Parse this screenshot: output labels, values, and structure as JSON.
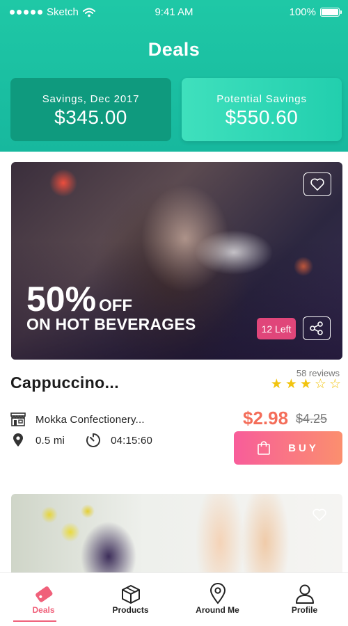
{
  "status_bar": {
    "carrier": "Sketch",
    "time": "9:41 AM",
    "battery": "100%",
    "battery_level": 1.0
  },
  "header": {
    "title": "Deals",
    "savings_cards": [
      {
        "label": "Savings, Dec 2017",
        "value": "$345.00"
      },
      {
        "label": "Potential Savings",
        "value": "$550.60"
      }
    ]
  },
  "deal": {
    "discount_percent": "50%",
    "discount_off": "OFF",
    "discount_subtitle": "ON HOT BEVERAGES",
    "stock_badge": "12 Left",
    "title": "Cappuccino...",
    "reviews": "58 reviews",
    "rating": 3,
    "rating_max": 5,
    "merchant": "Mokka Confectionery...",
    "distance": "0.5 mi",
    "time_left": "04:15:60",
    "price_new": "$2.98",
    "price_old": "$4.25",
    "buy_label": "BUY"
  },
  "tabs": [
    {
      "label": "Deals",
      "icon": "tag-icon",
      "active": true
    },
    {
      "label": "Products",
      "icon": "box-icon",
      "active": false
    },
    {
      "label": "Around Me",
      "icon": "location-pin-icon",
      "active": false
    },
    {
      "label": "Profile",
      "icon": "user-icon",
      "active": false
    }
  ],
  "colors": {
    "header_bg": "#1fc8a6",
    "savings_dark": "#0f9a7e",
    "accent_pink": "#f0607a",
    "price": "#f46e5a",
    "star": "#f2c40f",
    "badge": "#e0467a"
  }
}
